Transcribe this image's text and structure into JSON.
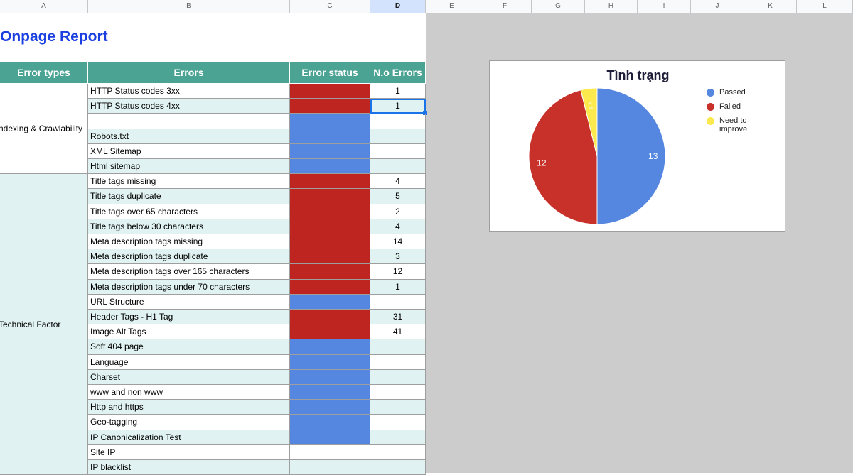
{
  "columns": [
    "A",
    "B",
    "C",
    "D",
    "E",
    "F",
    "G",
    "H",
    "I",
    "J",
    "K",
    "L"
  ],
  "selected_column": "D",
  "report_title": "Onpage Report",
  "table": {
    "headers": [
      "Error types",
      "Errors",
      "Error status",
      "N.o Errors"
    ],
    "groups": [
      {
        "label": "Indexing & Crawlability",
        "display": "ndexing & Crawlability"
      },
      {
        "label": "Technical Factor",
        "display": "Technical Factor"
      }
    ],
    "rows": [
      {
        "error": "HTTP Status codes 3xx",
        "status": "red",
        "count": "1"
      },
      {
        "error": "HTTP Status codes 4xx",
        "status": "red",
        "count": "1"
      },
      {
        "error": "",
        "status": "blue",
        "count": ""
      },
      {
        "error": "Robots.txt",
        "status": "blue",
        "count": ""
      },
      {
        "error": "XML Sitemap",
        "status": "blue",
        "count": ""
      },
      {
        "error": "Html sitemap",
        "status": "blue",
        "count": ""
      },
      {
        "error": "Title tags missing",
        "status": "red",
        "count": "4"
      },
      {
        "error": "Title tags duplicate",
        "status": "red",
        "count": "5"
      },
      {
        "error": "Title tags over 65 characters",
        "status": "red",
        "count": "2"
      },
      {
        "error": "Title tags below 30 characters",
        "status": "red",
        "count": "4"
      },
      {
        "error": "Meta description tags missing",
        "status": "red",
        "count": "14"
      },
      {
        "error": "Meta description tags duplicate",
        "status": "red",
        "count": "3"
      },
      {
        "error": "Meta description tags over 165 characters",
        "status": "red",
        "count": "12"
      },
      {
        "error": "Meta description tags under 70 characters",
        "status": "red",
        "count": "1"
      },
      {
        "error": "URL Structure",
        "status": "blue",
        "count": ""
      },
      {
        "error": "Header Tags - H1 Tag",
        "status": "red",
        "count": "31"
      },
      {
        "error": "Image Alt Tags",
        "status": "red",
        "count": "41"
      },
      {
        "error": "Soft 404 page",
        "status": "blue",
        "count": ""
      },
      {
        "error": "Language",
        "status": "blue",
        "count": ""
      },
      {
        "error": "Charset",
        "status": "blue",
        "count": ""
      },
      {
        "error": "www and non www",
        "status": "blue",
        "count": ""
      },
      {
        "error": "Http and https",
        "status": "blue",
        "count": ""
      },
      {
        "error": "Geo-tagging",
        "status": "blue",
        "count": ""
      },
      {
        "error": "IP Canonicalization Test",
        "status": "blue",
        "count": ""
      },
      {
        "error": "Site IP",
        "status": "white",
        "count": ""
      },
      {
        "error": "IP blacklist",
        "status": "white",
        "count": ""
      }
    ]
  },
  "colors": {
    "failed": "#c8312a",
    "passed": "#5586e0",
    "improve": "#fbe94d",
    "status_red": "#bf2520",
    "status_blue": "#5586e0",
    "header_bg": "#4ba393",
    "title_blue": "#1a3fe0"
  },
  "chart_data": {
    "type": "pie",
    "title": "Tình trạng",
    "labels": [
      "Passed",
      "Failed",
      "Need to improve"
    ],
    "values": [
      13,
      12,
      1
    ],
    "colors": [
      "#5586e0",
      "#c8312a",
      "#fbe94d"
    ],
    "legend_position": "right",
    "slice_labels": [
      "13",
      "12",
      "1"
    ]
  }
}
